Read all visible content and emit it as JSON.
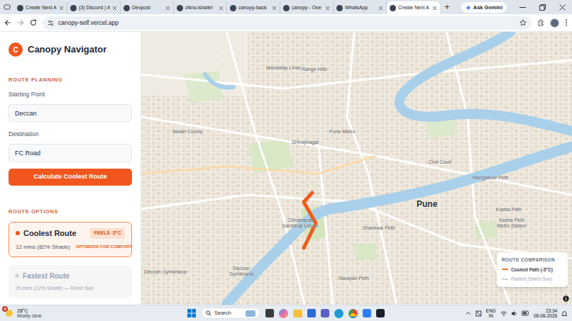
{
  "browser": {
    "tabs": [
      {
        "label": "Create Next A",
        "selected": false
      },
      {
        "label": "(3) Discord | #",
        "selected": false
      },
      {
        "label": "Devpost",
        "selected": false
      },
      {
        "label": "zikra-ishaikh",
        "selected": false
      },
      {
        "label": "canopy-back",
        "selected": false
      },
      {
        "label": "canopy - Ove",
        "selected": false
      },
      {
        "label": "WhatsApp",
        "selected": false
      },
      {
        "label": "Create Next A",
        "selected": true
      }
    ],
    "new_tab": "+",
    "gemini": "Ask Gemini",
    "url": "canopy-self.vercel.app"
  },
  "app": {
    "logo": "C",
    "title": "Canopy Navigator"
  },
  "planning": {
    "heading": "ROUTE PLANNING",
    "start_label": "Starting Point",
    "start_value": "Deccan",
    "dest_label": "Destination",
    "dest_value": "FC Road",
    "button": "Calculate Coolest Route"
  },
  "options": {
    "heading": "ROUTE OPTIONS",
    "routes": [
      {
        "name": "Coolest Route",
        "badge": "FEELS -5°C",
        "detail": "12 mins (82% Shade)",
        "note": "OPTIMIZED FOR COMFORT",
        "selected": true
      },
      {
        "name": "Fastest Route",
        "detail": "15 mins (12% Shade) — Direct Sun",
        "selected": false
      }
    ]
  },
  "map": {
    "labels": [
      {
        "text": "Mandalay Lines",
        "kind": "area"
      },
      {
        "text": "Range Hills",
        "kind": "area"
      },
      {
        "text": "Model Colony",
        "kind": "area"
      },
      {
        "text": "Pune Metro",
        "kind": "area"
      },
      {
        "text": "Shivajinagar",
        "kind": "area"
      },
      {
        "text": "Civil Court",
        "kind": "area"
      },
      {
        "text": "Mangalwar Peth",
        "kind": "area"
      },
      {
        "text": "Pune",
        "kind": "city"
      },
      {
        "text": "Kasba Peth",
        "kind": "area"
      },
      {
        "text": "Kasba Peth Metro Station",
        "kind": "area"
      },
      {
        "text": "Chhatrapati Sambhaji Udyan",
        "kind": "area"
      },
      {
        "text": "Shaniwar Peth",
        "kind": "area"
      },
      {
        "text": "Deccan Gymkhana",
        "kind": "area"
      },
      {
        "text": "Deccan Gymkhana",
        "kind": "area"
      },
      {
        "text": "Narayan Peth",
        "kind": "area"
      }
    ],
    "legend": {
      "title": "ROUTE COMPARISON",
      "items": [
        {
          "label": "Coolest Path (-5°C)",
          "color": "#f26a21"
        },
        {
          "label": "Fastest (Direct Sun)",
          "color": "#cfd4da"
        }
      ]
    }
  },
  "taskbar": {
    "weather_badge": "4",
    "temperature": "28°C",
    "condition": "Mostly clear",
    "search": "Search",
    "language": "ENG",
    "region": "IN",
    "time": "23:34",
    "date": "06-06-2026"
  }
}
